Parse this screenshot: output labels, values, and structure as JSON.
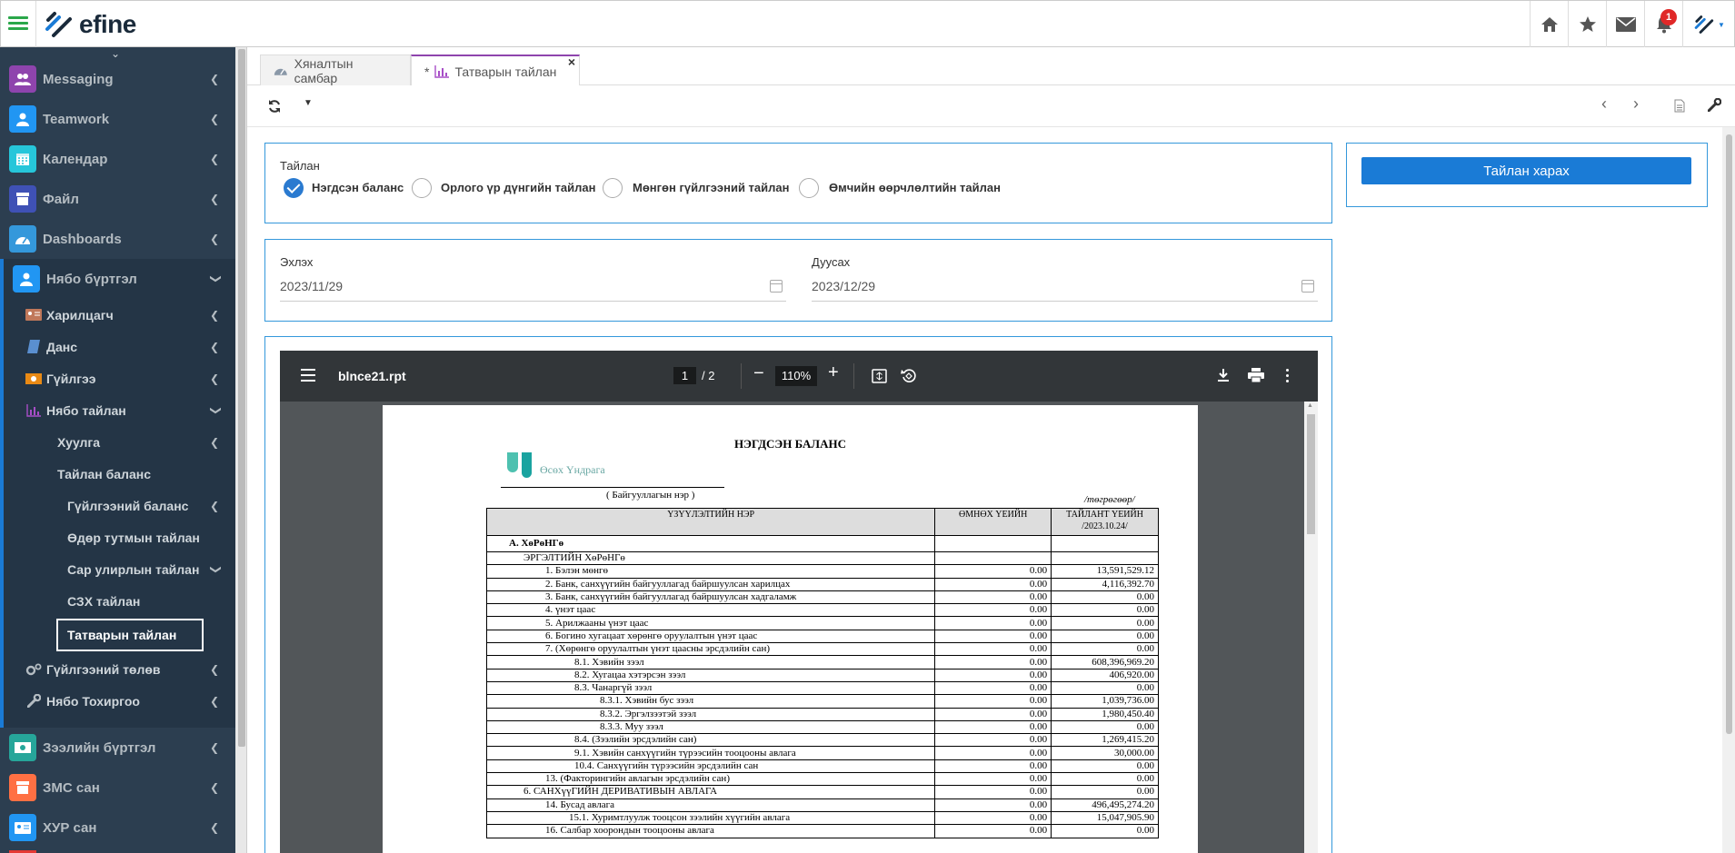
{
  "app": {
    "logo_text": "efine",
    "notification_count": "1"
  },
  "colors": {
    "accent": "#1a7bd6",
    "sidebar_bg": "#2c3e50",
    "tab_active": "#8e44ad",
    "hamburger": "#2aa74a"
  },
  "topbar": {
    "icons": [
      "home-icon",
      "star-icon",
      "mail-icon",
      "bell-icon",
      "user-menu-icon"
    ]
  },
  "sidebar": {
    "items": [
      {
        "label": "Messaging",
        "icon": "users-icon",
        "color": "#8e44ad"
      },
      {
        "label": "Teamwork",
        "icon": "user-icon",
        "color": "#2196f3"
      },
      {
        "label": "Календар",
        "icon": "calendar-icon",
        "color": "#26c6da"
      },
      {
        "label": "Файл",
        "icon": "file-icon",
        "color": "#3f51b5"
      },
      {
        "label": "Dashboards",
        "icon": "dashboard-icon",
        "color": "#3498db"
      },
      {
        "label": "Нябо бүртгэл",
        "icon": "user-icon",
        "color": "#2196f3"
      }
    ],
    "sub": [
      {
        "label": "Харилцагч",
        "icon": "contact-card-icon"
      },
      {
        "label": "Данс",
        "icon": "book-icon"
      },
      {
        "label": "Гүйлгээ",
        "icon": "money-icon"
      },
      {
        "label": "Нябо тайлан",
        "icon": "bar-chart-icon"
      }
    ],
    "sub2": [
      {
        "label": "Хуулга"
      },
      {
        "label": "Тайлан баланс"
      }
    ],
    "sub3": [
      {
        "label": "Гүйлгээний баланс"
      },
      {
        "label": "Өдөр тутмын тайлан"
      },
      {
        "label": "Сар улирлын тайлан"
      },
      {
        "label": "СЗХ тайлан"
      },
      {
        "label": "Татварын тайлан"
      }
    ],
    "sub_after": [
      {
        "label": "Гүйлгээний төлөв",
        "icon": "cogs-icon"
      },
      {
        "label": "Нябо Тохиргоо",
        "icon": "wrench-icon"
      }
    ],
    "items_after": [
      {
        "label": "Зээлийн бүртгэл",
        "icon": "money-icon",
        "color": "#26a69a"
      },
      {
        "label": "ЗМС сан",
        "icon": "box-icon",
        "color": "#ff7043"
      },
      {
        "label": "ХУР сан",
        "icon": "id-card-icon",
        "color": "#2196f3"
      }
    ]
  },
  "tabs": [
    {
      "label": "Хяналтын самбар"
    },
    {
      "label": "Татварын тайлан",
      "prefix": "*"
    }
  ],
  "form": {
    "report_label": "Тайлан",
    "options": [
      "Нэгдсэн баланс",
      "Орлого үр дүнгийн тайлан",
      "Мөнгөн гүйлгээний тайлан",
      "Өмчийн өөрчлөлтийн тайлан"
    ],
    "selected": "Нэгдсэн баланс",
    "start_label": "Эхлэх",
    "start_value": "2023/11/29",
    "end_label": "Дуусах",
    "end_value": "2023/12/29",
    "view_button": "Тайлан харах"
  },
  "pdf": {
    "filename": "blnce21.rpt",
    "page": "1",
    "page_total": "/ 2",
    "zoom": "110%",
    "title": "НЭГДСЭН БАЛАНС",
    "org_name": "Өсөх Үндрага",
    "org_caption": "( Байгууллагын нэр )",
    "currency_note": "/төгрөгөөр/",
    "headers": [
      "ҮЗҮҮЛЭЛТИЙН НЭР",
      "ӨМНӨХ ҮЕИЙН",
      "ТАЙЛАНТ ҮЕИЙН /2023.10.24/"
    ],
    "rows": [
      [
        "А. ХөРөНГө",
        "",
        ""
      ],
      [
        "ЭРГЭЛТИЙН ХөРөНГө",
        "",
        ""
      ],
      [
        "1. Бэлэн мөнгө",
        "0.00",
        "13,591,529.12"
      ],
      [
        "2. Банк, санхүүгийн байгууллагад байршуулсан харилцах",
        "0.00",
        "4,116,392.70"
      ],
      [
        "3. Банк, санхүүгийн байгууллагад байршуулсан хадгаламж",
        "0.00",
        "0.00"
      ],
      [
        "4. үнэт цаас",
        "0.00",
        "0.00"
      ],
      [
        "5. Арилжааны үнэт цаас",
        "0.00",
        "0.00"
      ],
      [
        "6. Богино хугацаат хөрөнгө оруулалтын үнэт цаас",
        "0.00",
        "0.00"
      ],
      [
        "7. (Хөрөнгө оруулалтын үнэт цаасны эрсдэлийн сан)",
        "0.00",
        "0.00"
      ],
      [
        "8.1. Хэвийн зээл",
        "0.00",
        "608,396,969.20"
      ],
      [
        "8.2. Хугацаа хэтэрсэн зээл",
        "0.00",
        "406,920.00"
      ],
      [
        "8.3. Чанаргүй зээл",
        "0.00",
        "0.00"
      ],
      [
        "8.3.1. Хэвийн бус зээл",
        "0.00",
        "1,039,736.00"
      ],
      [
        "8.3.2. Эргэлзээтэй зээл",
        "0.00",
        "1,980,450.40"
      ],
      [
        "8.3.3.  Муу зээл",
        "0.00",
        "0.00"
      ],
      [
        "8.4. (Зээлийн эрсдэлийн сан)",
        "0.00",
        "1,269,415.20"
      ],
      [
        "9.1. Хэвийн санхүүгийн түрээсийн тооцооны авлага",
        "0.00",
        "30,000.00"
      ],
      [
        "10.4. Санхүүгийн түрээсийн эрсдэлийн сан",
        "0.00",
        "0.00"
      ],
      [
        "13. (Факторингийн авлагын эрсдэлийн сан)",
        "0.00",
        "0.00"
      ],
      [
        "6. САНХүүГИЙН ДЕРИВАТИВЫН АВЛАГА",
        "0.00",
        "0.00"
      ],
      [
        "14. Бусад  авлага",
        "0.00",
        "496,495,274.20"
      ],
      [
        "15.1. Хуримтлуулж тооцсон зээлийн хүүгийн авлага",
        "0.00",
        "15,047,905.90"
      ],
      [
        "16. Салбар хоорондын тооцооны авлага",
        "0.00",
        "0.00"
      ]
    ]
  }
}
